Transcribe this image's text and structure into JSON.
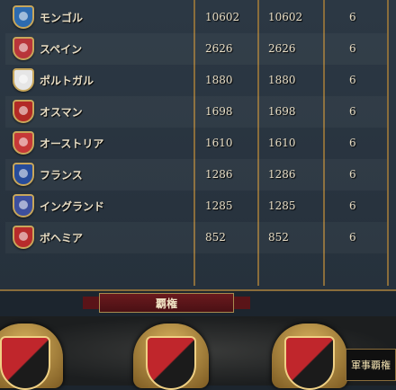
{
  "rows": [
    {
      "name": "モンゴル",
      "v1": "10602",
      "v2": "10602",
      "v3": "6",
      "color": "#2d6bb0",
      "shield_icon": "blue-shield-icon"
    },
    {
      "name": "スペイン",
      "v1": "2626",
      "v2": "2626",
      "v3": "6",
      "color": "#b8353a",
      "shield_icon": "red-yellow-shield-icon"
    },
    {
      "name": "ポルトガル",
      "v1": "1880",
      "v2": "1880",
      "v3": "6",
      "color": "#e6e6e6",
      "shield_icon": "white-blue-shield-icon"
    },
    {
      "name": "オスマン",
      "v1": "1698",
      "v2": "1698",
      "v3": "6",
      "color": "#b22a26",
      "shield_icon": "crescent-shield-icon"
    },
    {
      "name": "オーストリア",
      "v1": "1610",
      "v2": "1610",
      "v3": "6",
      "color": "#c63838",
      "shield_icon": "red-white-shield-icon"
    },
    {
      "name": "フランス",
      "v1": "1286",
      "v2": "1286",
      "v3": "6",
      "color": "#274c9a",
      "shield_icon": "fleur-de-lis-shield-icon"
    },
    {
      "name": "イングランド",
      "v1": "1285",
      "v2": "1285",
      "v3": "6",
      "color": "#3d4f9d",
      "shield_icon": "quartered-shield-icon"
    },
    {
      "name": "ボヘミア",
      "v1": "852",
      "v2": "852",
      "v3": "6",
      "color": "#b72b2b",
      "shield_icon": "lion-shield-icon"
    }
  ],
  "banner": {
    "label": "覇権"
  },
  "tooltip": {
    "label": "軍事覇権"
  },
  "crests": [
    "military-crest-icon",
    "trade-crest-icon",
    "culture-crest-icon"
  ]
}
